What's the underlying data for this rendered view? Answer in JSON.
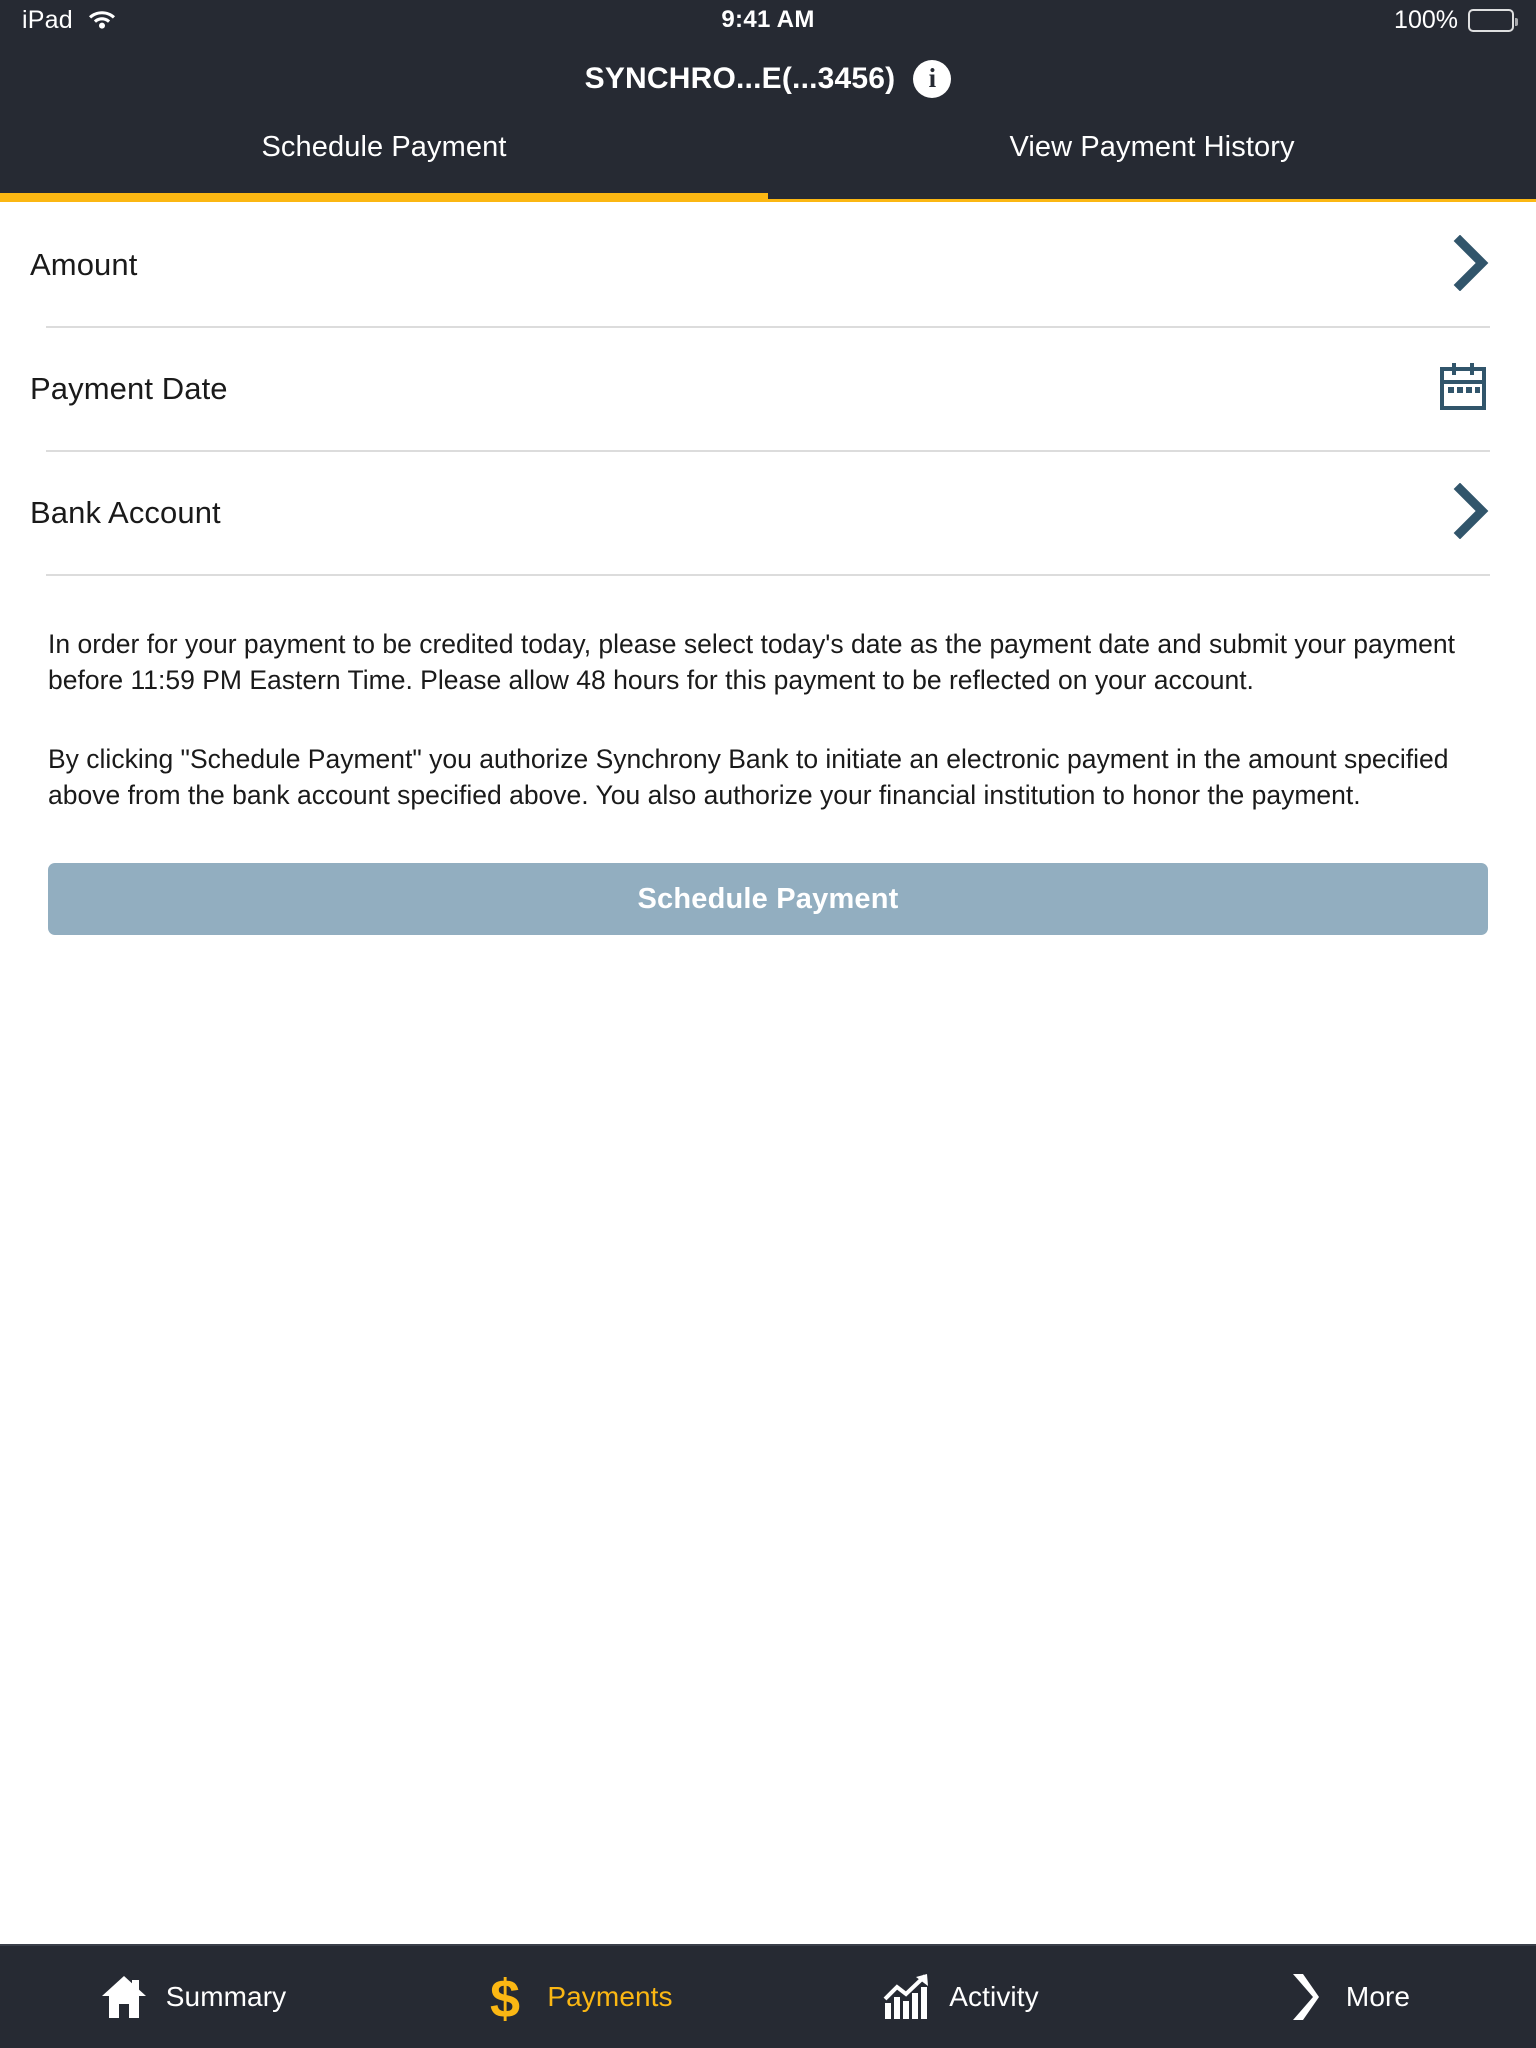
{
  "status_bar": {
    "device": "iPad",
    "wifi_icon": "wifi-icon",
    "time": "9:41 AM",
    "battery_percent": "100%",
    "battery_icon": "battery-icon"
  },
  "header": {
    "title": "SYNCHRO...E(...3456)",
    "info_icon": "info-icon",
    "info_glyph": "i"
  },
  "tabs": [
    {
      "label": "Schedule Payment",
      "active": true
    },
    {
      "label": "View Payment History",
      "active": false
    }
  ],
  "form_rows": [
    {
      "label": "Amount",
      "accessory": "chevron-right-icon"
    },
    {
      "label": "Payment Date",
      "accessory": "calendar-icon"
    },
    {
      "label": "Bank Account",
      "accessory": "chevron-right-icon"
    }
  ],
  "disclosures": [
    "In order for your payment to be credited today, please select today's date as the payment date and submit your payment before 11:59 PM Eastern Time. Please allow 48 hours for this payment to be reflected on your account.",
    "By clicking \"Schedule Payment\" you authorize Synchrony Bank to initiate an electronic payment in the amount specified above from the bank account specified above. You also authorize your financial institution to honor the payment."
  ],
  "primary_button": {
    "label": "Schedule Payment",
    "enabled": false
  },
  "bottom_nav": [
    {
      "label": "Summary",
      "icon": "home-icon",
      "active": false
    },
    {
      "label": "Payments",
      "icon": "dollar-icon",
      "active": true
    },
    {
      "label": "Activity",
      "icon": "chart-icon",
      "active": false
    },
    {
      "label": "More",
      "icon": "chevron-icon",
      "active": false
    }
  ],
  "colors": {
    "header_bg": "#262a33",
    "accent_yellow": "#fbb713",
    "chevron_blue": "#31556b",
    "button_disabled": "#92aec0",
    "divider": "#dcdcdc"
  }
}
